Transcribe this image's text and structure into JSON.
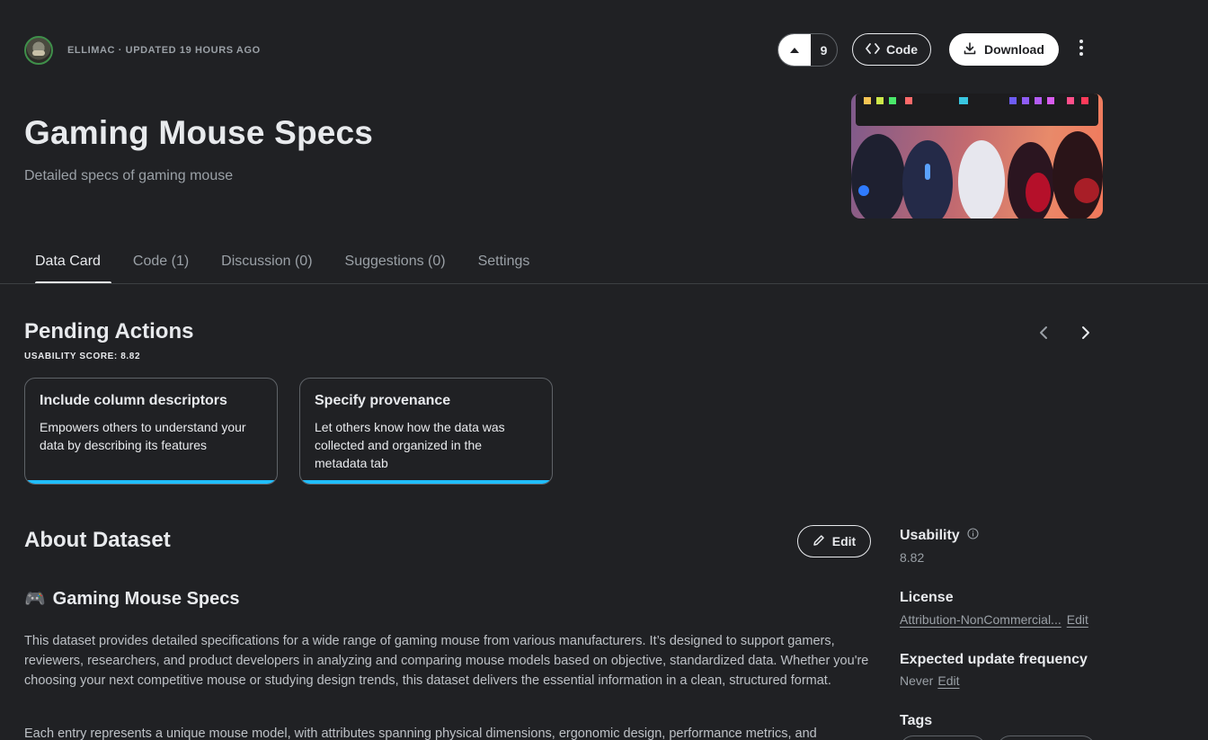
{
  "header": {
    "meta": "ELLIMAC · UPDATED 19 HOURS AGO",
    "upvotes": "9",
    "code_label": "Code",
    "download_label": "Download"
  },
  "dataset": {
    "title": "Gaming Mouse Specs",
    "subtitle": "Detailed specs of gaming mouse"
  },
  "tabs": [
    {
      "label": "Data Card",
      "active": true
    },
    {
      "label": "Code (1)"
    },
    {
      "label": "Discussion (0)"
    },
    {
      "label": "Suggestions (0)"
    },
    {
      "label": "Settings"
    }
  ],
  "pending": {
    "title": "Pending Actions",
    "score": "USABILITY SCORE: 8.82",
    "cards": [
      {
        "title": "Include column descriptors",
        "body": "Empowers others to understand your data by describing its features"
      },
      {
        "title": "Specify provenance",
        "body": "Let others know how the data was collected and organized in the metadata tab"
      }
    ]
  },
  "about": {
    "title": "About Dataset",
    "edit_label": "Edit",
    "heading_icon": "🎮",
    "heading": "Gaming Mouse Specs",
    "para1": "This dataset provides detailed specifications for a wide range of gaming mouse from various manufacturers. It’s designed to support gamers, reviewers, researchers, and product developers in analyzing and comparing mouse models based on objective, standardized data. Whether you're choosing your next competitive mouse or studying design trends, this dataset delivers the essential information in a clean, structured format.",
    "para2": "Each entry represents a unique mouse model, with attributes spanning physical dimensions, ergonomic design, performance metrics, and"
  },
  "sidebar": {
    "usability_label": "Usability",
    "usability_value": "8.82",
    "license_label": "License",
    "license_value": "Attribution-NonCommercial...",
    "license_edit": "Edit",
    "freq_label": "Expected update frequency",
    "freq_value": "Never",
    "freq_edit": "Edit",
    "tags_label": "Tags"
  },
  "colors": {
    "background": "#202124",
    "accent": "#20beff"
  }
}
